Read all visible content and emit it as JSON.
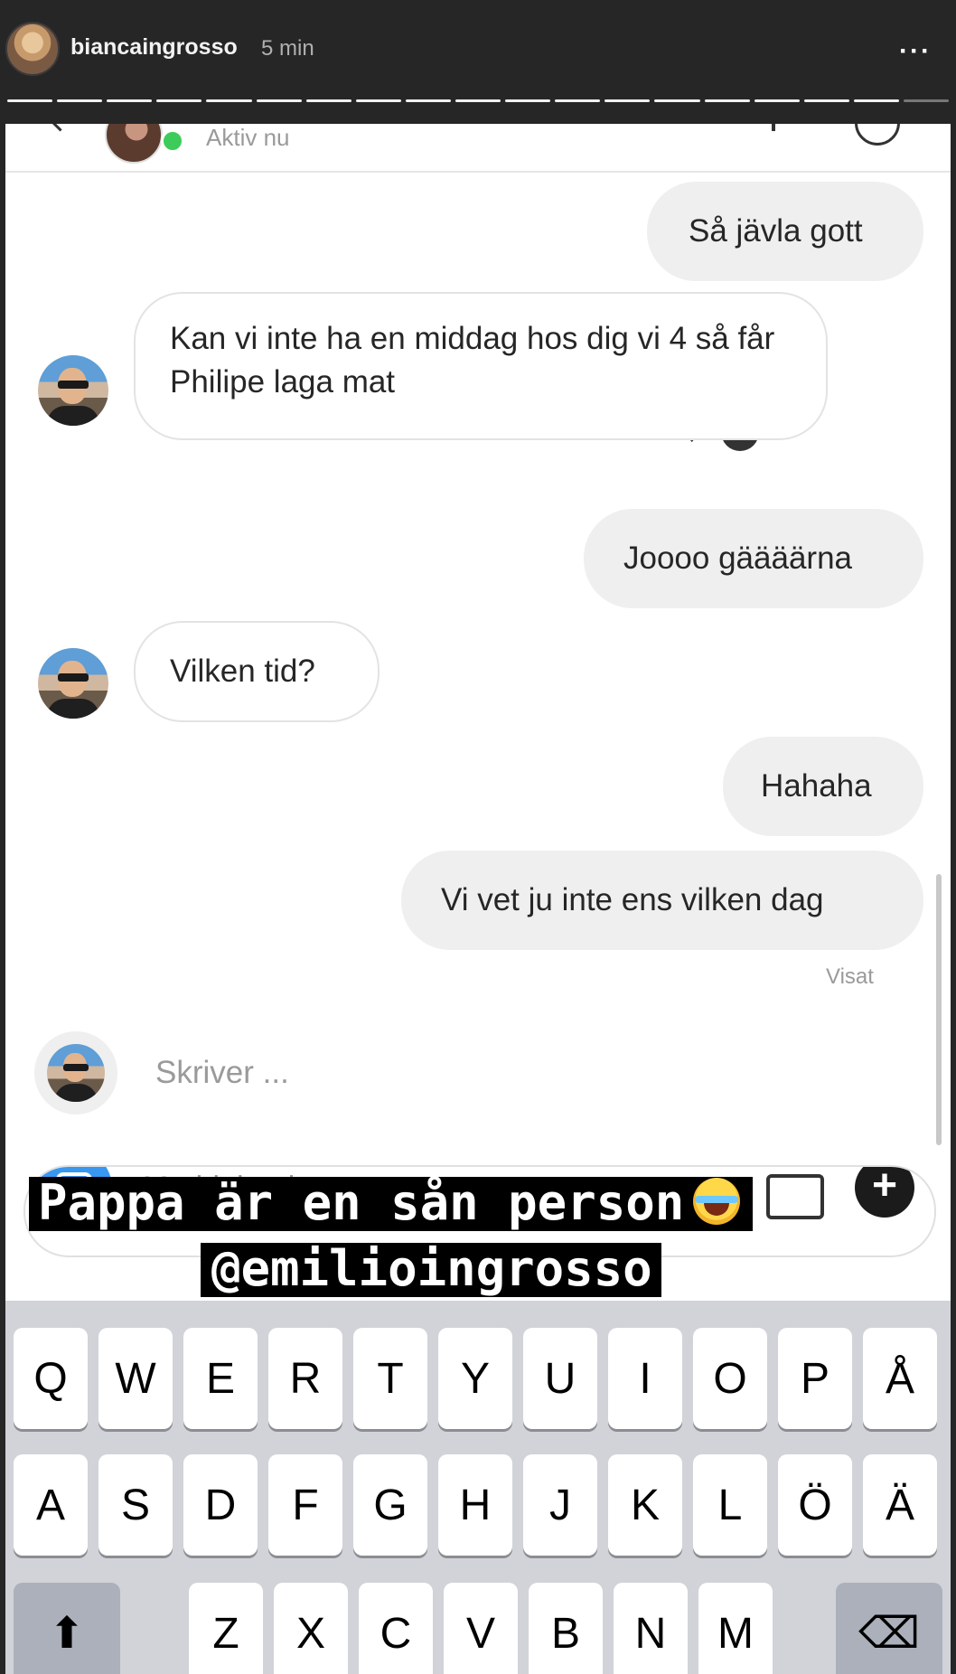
{
  "story": {
    "username": "biancaingrosso",
    "time": "5 min",
    "more_icon": "···",
    "segments_seen": 18,
    "segments_total": 19
  },
  "chat": {
    "status": "Aktiv nu",
    "messages": [
      {
        "side": "out",
        "text": "Så jävla gott"
      },
      {
        "side": "in",
        "text": "Kan vi inte ha en middag hos dig vi 4 så får Philipe laga mat"
      },
      {
        "side": "out",
        "text": "Joooo gäääärna"
      },
      {
        "side": "in",
        "text": "Vilken tid?"
      },
      {
        "side": "out",
        "text": "Hahaha"
      },
      {
        "side": "out",
        "text": "Vi vet ju inte ens vilken dag"
      }
    ],
    "seen": "Visat",
    "typing": "Skriver ...",
    "composer_placeholder": "Meddelande ..."
  },
  "caption": {
    "line1": "Pappa är en sån person",
    "emoji": "face-with-tears-of-joy",
    "mention": "@emilioingrosso"
  },
  "keyboard": {
    "row1": [
      "Q",
      "W",
      "E",
      "R",
      "T",
      "Y",
      "U",
      "I",
      "O",
      "P",
      "Å"
    ],
    "row2": [
      "A",
      "S",
      "D",
      "F",
      "G",
      "H",
      "J",
      "K",
      "L",
      "Ö",
      "Ä"
    ],
    "row3": [
      "Z",
      "X",
      "C",
      "V",
      "B",
      "N",
      "M"
    ],
    "shift_icon": "⬆",
    "backspace_icon": "⌫"
  },
  "colors": {
    "story_bg": "#262626",
    "online": "#3dcc5a",
    "camera_button": "#3897f0",
    "keyboard_bg": "#d1d3d9"
  }
}
